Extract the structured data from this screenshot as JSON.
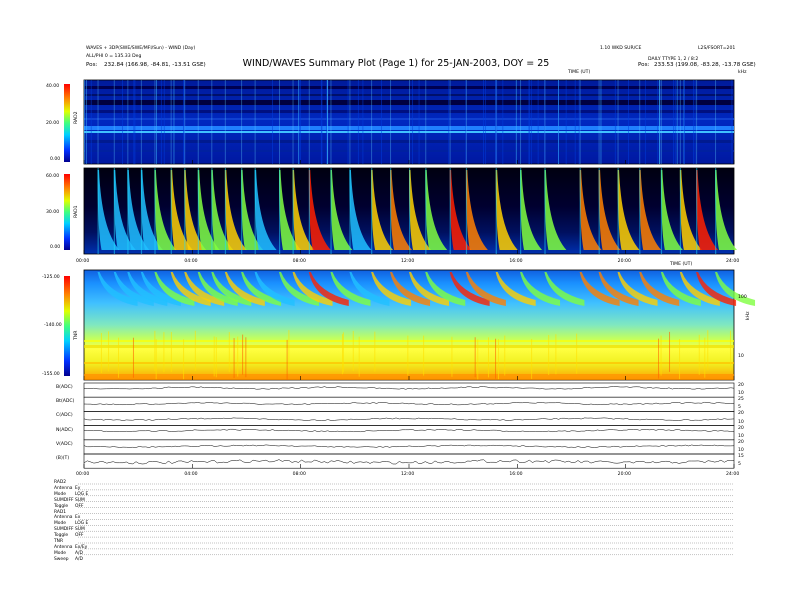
{
  "header": {
    "left_line1": "WAVES + 3DP(SWE/SWE/MFI/Sun) - WIND (Day)",
    "left_line2": "ALL/PHI 0 = 135.33 Deg",
    "left_line3_label": "Pos:",
    "left_line3_value": "232.84 (166.98, -84.81, -13.51 GSE)",
    "right_line1": "1.10 WKD SUR/CE",
    "right_line1b": "L2S/FSORT=201",
    "right_line2": "DAILY TTYPE 1, 2 / 8:2",
    "right_line3_label": "Pos:",
    "right_line3_value": "233.53 (199.08, -83.28, -13.78 GSE)",
    "title": "WIND/WAVES Summary Plot (Page 1) for 25-JAN-2003, DOY = 25",
    "time_axis_label": "TIME (UT)"
  },
  "colors": {
    "frame": "#000000",
    "background_low": "#000080",
    "bright_burst": "#ff2000",
    "trace": "#000000"
  },
  "rad2": {
    "label": "RAD2",
    "ytick_labels": [
      "40.00",
      "20.00",
      "0.00"
    ],
    "right_labels": [
      "14.0",
      "1.0"
    ],
    "corner_label": "kHz"
  },
  "rad1": {
    "label": "RAD1",
    "ytick_labels": [
      "60.00",
      "30.00",
      "0.00"
    ]
  },
  "tnr": {
    "label": "TNR",
    "ytick_labels": [
      "-125.00",
      "-140.00",
      "-155.00"
    ],
    "right_labels": [
      "100",
      "10"
    ],
    "freq_unit": "kHz",
    "bottom_right_label": "dB(V)"
  },
  "time_ticks": [
    "00:00",
    "04:00",
    "08:00",
    "12:00",
    "16:00",
    "20:00",
    "24:00"
  ],
  "traces": [
    {
      "label": "B(ADC)",
      "right": [
        "20",
        "10"
      ]
    },
    {
      "label": "Bt(ADC)",
      "right": [
        "25",
        "5"
      ]
    },
    {
      "label": "C(ADC)",
      "right": [
        "20",
        "10"
      ]
    },
    {
      "label": "N(ADC)",
      "right": [
        "20",
        "10"
      ]
    },
    {
      "label": "V(ADC)",
      "right": [
        "20",
        "10"
      ]
    },
    {
      "label": "(B)(T)",
      "right": [
        "15",
        "5"
      ]
    }
  ],
  "footer": {
    "rad2": {
      "title": "RAD2",
      "rows": [
        [
          "Antenna",
          "Ey"
        ],
        [
          "Mode",
          "LOG E"
        ],
        [
          "SUMDIFF",
          "SUM"
        ],
        [
          "Toggle",
          "OFF"
        ]
      ]
    },
    "rad1": {
      "title": "RAD1",
      "rows": [
        [
          "Antenna",
          "Ex"
        ],
        [
          "Mode",
          "LOG E"
        ],
        [
          "SUMDIFF",
          "SUM"
        ],
        [
          "Toggle",
          "OFF"
        ]
      ]
    },
    "tnr": {
      "title": "TNR",
      "rows": [
        [
          "Antenna",
          "Ex/Ey"
        ],
        [
          "Mode",
          "A/D"
        ],
        [
          "Sweep",
          "A/D"
        ]
      ]
    }
  },
  "chart_data": {
    "type": "heatmap",
    "title": "WIND/WAVES Summary Plot (Page 1) for 25-JAN-2003, DOY = 25",
    "xlabel": "TIME (UT)",
    "x_range_hours": [
      0,
      24
    ],
    "panels": [
      {
        "name": "RAD2",
        "ylim": [
          0,
          40
        ],
        "colorbar_range": [
          0,
          40
        ]
      },
      {
        "name": "RAD1",
        "ylim": [
          0,
          60
        ],
        "colorbar_range": [
          0,
          60
        ]
      },
      {
        "name": "TNR",
        "ylim": [
          -155,
          -125
        ],
        "colorbar_range": [
          -155,
          -125
        ],
        "freq_scale": "log"
      }
    ],
    "type_iii_burst_times_hours": [
      0.5,
      1.1,
      1.6,
      2.1,
      2.6,
      3.2,
      3.7,
      4.2,
      4.7,
      5.2,
      5.8,
      6.3,
      7.2,
      7.7,
      8.3,
      9.1,
      9.8,
      10.6,
      11.3,
      12.0,
      12.6,
      13.5,
      14.1,
      15.2,
      16.1,
      17.0,
      18.3,
      19.0,
      19.7,
      20.5,
      21.3,
      22.0,
      22.6,
      23.3
    ],
    "type_iii_burst_intensity": [
      0.5,
      0.6,
      0.55,
      0.6,
      0.7,
      0.8,
      0.75,
      0.65,
      0.7,
      0.8,
      0.7,
      0.6,
      0.7,
      0.8,
      0.95,
      0.7,
      0.6,
      0.8,
      0.85,
      0.75,
      0.7,
      1.0,
      0.9,
      0.8,
      0.7,
      0.65,
      0.9,
      0.85,
      0.8,
      0.9,
      0.7,
      0.8,
      0.95,
      0.7
    ]
  }
}
